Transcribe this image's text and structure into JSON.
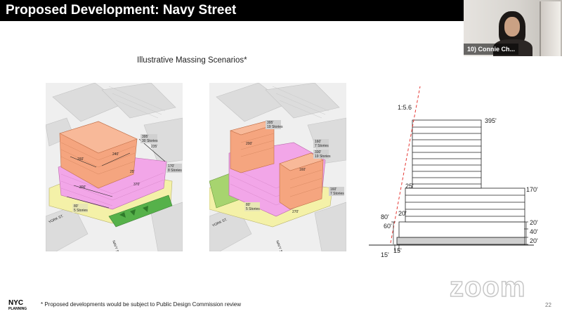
{
  "slide": {
    "title": "Proposed Development: Navy Street",
    "subtitle": "Illustrative Massing Scenarios*",
    "footnote": "* Proposed developments would be subject to Public Design Commission review",
    "slide_number": "22"
  },
  "logo": {
    "line1": "NYC",
    "line2": "PLANNING"
  },
  "video": {
    "participant_name": "10) Connie Ch..."
  },
  "zoom": {
    "watermark": "zoom"
  },
  "scenario_a": {
    "street_left": "YORK ST.",
    "street_right": "NAVY ST.",
    "labels": [
      "395'",
      "30 Stories",
      "170'",
      "8 Stories",
      "80'",
      "5 Stories",
      "160'",
      "240'",
      "235'",
      "25'",
      "300'",
      "370'"
    ]
  },
  "scenario_b": {
    "street_left": "YORK ST.",
    "street_right": "NAVY ST.",
    "labels": [
      "395'",
      "19 Stories",
      "160'",
      "7 Stories",
      "330'",
      "19 Stories",
      "160'",
      "7 Stories",
      "80'",
      "5 Stories",
      "200'",
      "160'",
      "270'"
    ]
  },
  "section_diagram": {
    "slope": "1:5.6",
    "labels": [
      "395'",
      "25'",
      "170'",
      "80'",
      "20'",
      "60'",
      "20'",
      "40'",
      "20'",
      "15'",
      "15'"
    ]
  },
  "colors": {
    "title_bar": "#000000",
    "tower": "#f5a57f",
    "podium": "#f2a6e8",
    "base": "#f4f1a8",
    "green": "#56b14a",
    "slope_line": "#e53935"
  }
}
